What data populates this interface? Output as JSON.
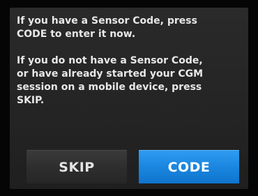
{
  "dialog": {
    "paragraph_1": {
      "line_1": "If you have a Sensor Code, press",
      "line_2": "CODE to enter it now."
    },
    "paragraph_2": {
      "line_1": "If you do not have a Sensor Code,",
      "line_2": "or have already started your CGM",
      "line_3": "session on a mobile device, press",
      "line_4": "SKIP."
    }
  },
  "buttons": {
    "skip_label": "SKIP",
    "code_label": "CODE"
  },
  "colors": {
    "background": "#050505",
    "panel": "#262626",
    "text": "#e8e8e8",
    "skip_button": "#2e2e2e",
    "code_button": "#1a86e0"
  }
}
